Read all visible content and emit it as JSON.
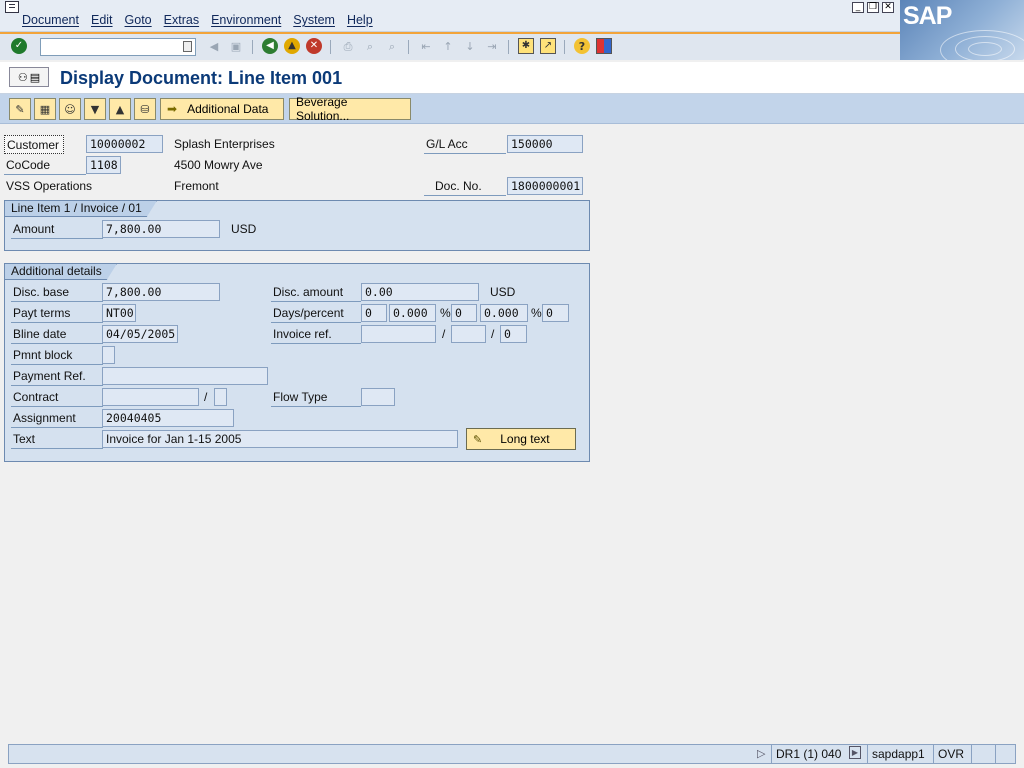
{
  "menu": {
    "items": [
      "Document",
      "Edit",
      "Goto",
      "Extras",
      "Environment",
      "System",
      "Help"
    ]
  },
  "window_controls": [
    "minimize",
    "restore",
    "close"
  ],
  "logo_text": "SAP",
  "standard_toolbar": {
    "command_field_value": "",
    "icons": [
      "enter-check-icon",
      "back-nav-icon",
      "save-icon",
      "back-icon",
      "exit-icon",
      "cancel-icon",
      "print-icon",
      "find-icon",
      "find-next-icon",
      "first-page-icon",
      "previous-page-icon",
      "next-page-icon",
      "last-page-icon",
      "create-session-icon",
      "shortcut-icon",
      "help-icon",
      "layout-menu-icon"
    ]
  },
  "title": "Display Document: Line Item 001",
  "app_toolbar": {
    "icons": [
      "change-display-icon",
      "call-up-document-overview-icon",
      "display-person-icon",
      "next-item-icon",
      "previous-item-icon",
      "display-reference-icon"
    ],
    "additional_data_label": "Additional Data",
    "beverage_solution_label": "Beverage Solution..."
  },
  "header": {
    "customer_label": "Customer",
    "customer_value": "10000002",
    "customer_name": "Splash Enterprises",
    "gl_acc_label": "G/L Acc",
    "gl_acc_value": "150000",
    "cocode_label": "CoCode",
    "cocode_value": "1108",
    "street": "4500 Mowry Ave",
    "company_name": "VSS Operations",
    "city": "Fremont",
    "doc_no_label": "Doc. No.",
    "doc_no_value": "1800000001"
  },
  "line_item": {
    "group_title": "Line Item 1 / Invoice / 01",
    "amount_label": "Amount",
    "amount_value": "7,800.00",
    "currency": "USD"
  },
  "additional_details": {
    "group_title": "Additional details",
    "disc_base_label": "Disc. base",
    "disc_base_value": "7,800.00",
    "disc_amount_label": "Disc. amount",
    "disc_amount_value": "0.00",
    "disc_currency": "USD",
    "payt_terms_label": "Payt terms",
    "payt_terms_value": "NT00",
    "days_percent_label": "Days/percent",
    "days1": "0",
    "pct1": "0.000",
    "days2": "0",
    "pct2": "0.000",
    "days3": "0",
    "pct_sign": "%",
    "bline_date_label": "Bline date",
    "bline_date_value": "04/05/2005",
    "invoice_ref_label": "Invoice ref.",
    "invoice_ref_1": "",
    "invoice_ref_2": "",
    "invoice_ref_3": "0",
    "slash": "/",
    "pmnt_block_label": "Pmnt block",
    "pmnt_block_value": "",
    "payment_ref_label": "Payment Ref.",
    "payment_ref_value": "",
    "contract_label": "Contract",
    "contract_value": "",
    "contract_item": "",
    "flow_type_label": "Flow Type",
    "flow_type_value": "",
    "assignment_label": "Assignment",
    "assignment_value": "20040405",
    "text_label": "Text",
    "text_value": "Invoice for Jan 1-15 2005",
    "long_text_label": "Long text"
  },
  "status_bar": {
    "system": "DR1 (1) 040",
    "server": "sapdapp1",
    "mode": "OVR"
  }
}
